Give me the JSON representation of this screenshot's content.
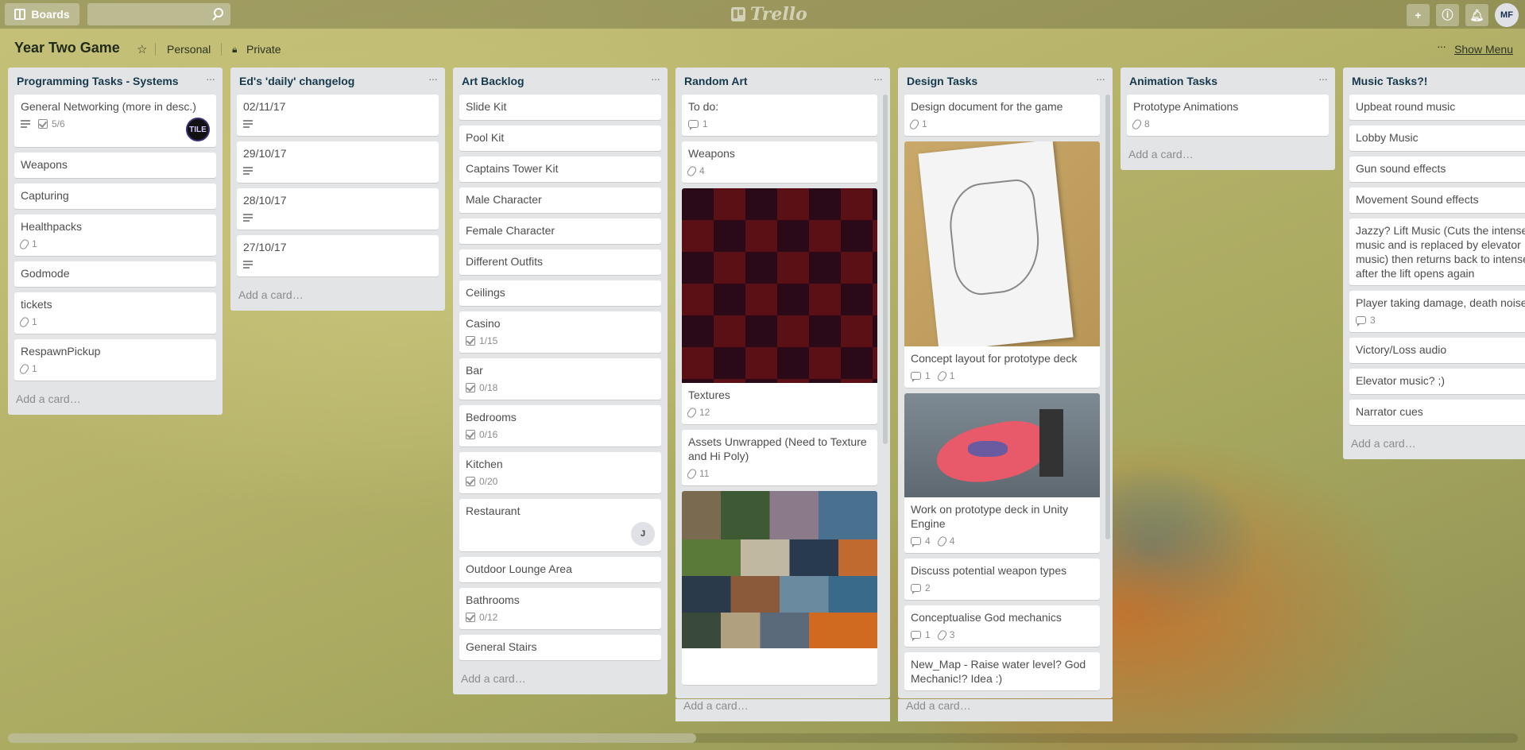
{
  "header": {
    "boards_label": "Boards",
    "logo_text": "Trello",
    "user_initials": "MF"
  },
  "board": {
    "title": "Year Two Game",
    "team": "Personal",
    "visibility": "Private",
    "show_menu": "Show Menu"
  },
  "add_card_label": "Add a card…",
  "lists": [
    {
      "title": "Programming Tasks - Systems",
      "cards": [
        {
          "title": "General Networking (more in desc.)",
          "checklist": "5/6",
          "member": "TILE"
        },
        {
          "title": "Weapons"
        },
        {
          "title": "Capturing"
        },
        {
          "title": "Healthpacks",
          "attachments": "1"
        },
        {
          "title": "Godmode"
        },
        {
          "title": "tickets",
          "attachments": "1"
        },
        {
          "title": "RespawnPickup",
          "attachments": "1"
        }
      ]
    },
    {
      "title": "Ed's 'daily' changelog",
      "cards": [
        {
          "title": "02/11/17"
        },
        {
          "title": "29/10/17"
        },
        {
          "title": "28/10/17"
        },
        {
          "title": "27/10/17"
        }
      ]
    },
    {
      "title": "Art Backlog",
      "cards": [
        {
          "title": "Slide Kit"
        },
        {
          "title": "Pool Kit"
        },
        {
          "title": "Captains Tower Kit"
        },
        {
          "title": "Male Character"
        },
        {
          "title": "Female Character"
        },
        {
          "title": "Different Outfits"
        },
        {
          "title": "Ceilings"
        },
        {
          "title": "Casino",
          "checklist": "1/15"
        },
        {
          "title": "Bar",
          "checklist": "0/18"
        },
        {
          "title": "Bedrooms",
          "checklist": "0/16"
        },
        {
          "title": "Kitchen",
          "checklist": "0/20"
        },
        {
          "title": "Restaurant",
          "member": "J"
        },
        {
          "title": "Outdoor Lounge Area"
        },
        {
          "title": "Bathrooms",
          "checklist": "0/12"
        },
        {
          "title": "General Stairs"
        }
      ]
    },
    {
      "title": "Random Art",
      "cards": [
        {
          "title": "To do:",
          "comments": "1"
        },
        {
          "title": "Weapons",
          "attachments": "4"
        },
        {
          "title": "Textures",
          "attachments": "12"
        },
        {
          "title": "Assets Unwrapped (Need to Texture and Hi Poly)",
          "attachments": "11"
        }
      ]
    },
    {
      "title": "Design Tasks",
      "cards": [
        {
          "title": "Design document for the game",
          "attachments": "1"
        },
        {
          "title": "Concept layout for prototype deck",
          "comments": "1",
          "attachments": "1"
        },
        {
          "title": "Work on prototype deck in Unity Engine",
          "comments": "4",
          "attachments": "4"
        },
        {
          "title": "Discuss potential weapon types",
          "comments": "2"
        },
        {
          "title": "Conceptualise God mechanics",
          "comments": "1",
          "attachments": "3"
        },
        {
          "title": "New_Map - Raise water level? God Mechanic!? Idea :)"
        }
      ]
    },
    {
      "title": "Animation Tasks",
      "cards": [
        {
          "title": "Prototype Animations",
          "attachments": "8"
        }
      ]
    },
    {
      "title": "Music Tasks?!",
      "cards": [
        {
          "title": "Upbeat round music"
        },
        {
          "title": "Lobby Music"
        },
        {
          "title": "Gun sound effects"
        },
        {
          "title": "Movement Sound effects"
        },
        {
          "title": "Jazzy? Lift Music (Cuts the intense music and is replaced by elevator music) then returns back to intense after the lift opens again"
        },
        {
          "title": "Player taking damage, death noise",
          "comments": "3"
        },
        {
          "title": "Victory/Loss audio"
        },
        {
          "title": "Elevator music? ;)"
        },
        {
          "title": "Narrator cues"
        }
      ]
    }
  ]
}
